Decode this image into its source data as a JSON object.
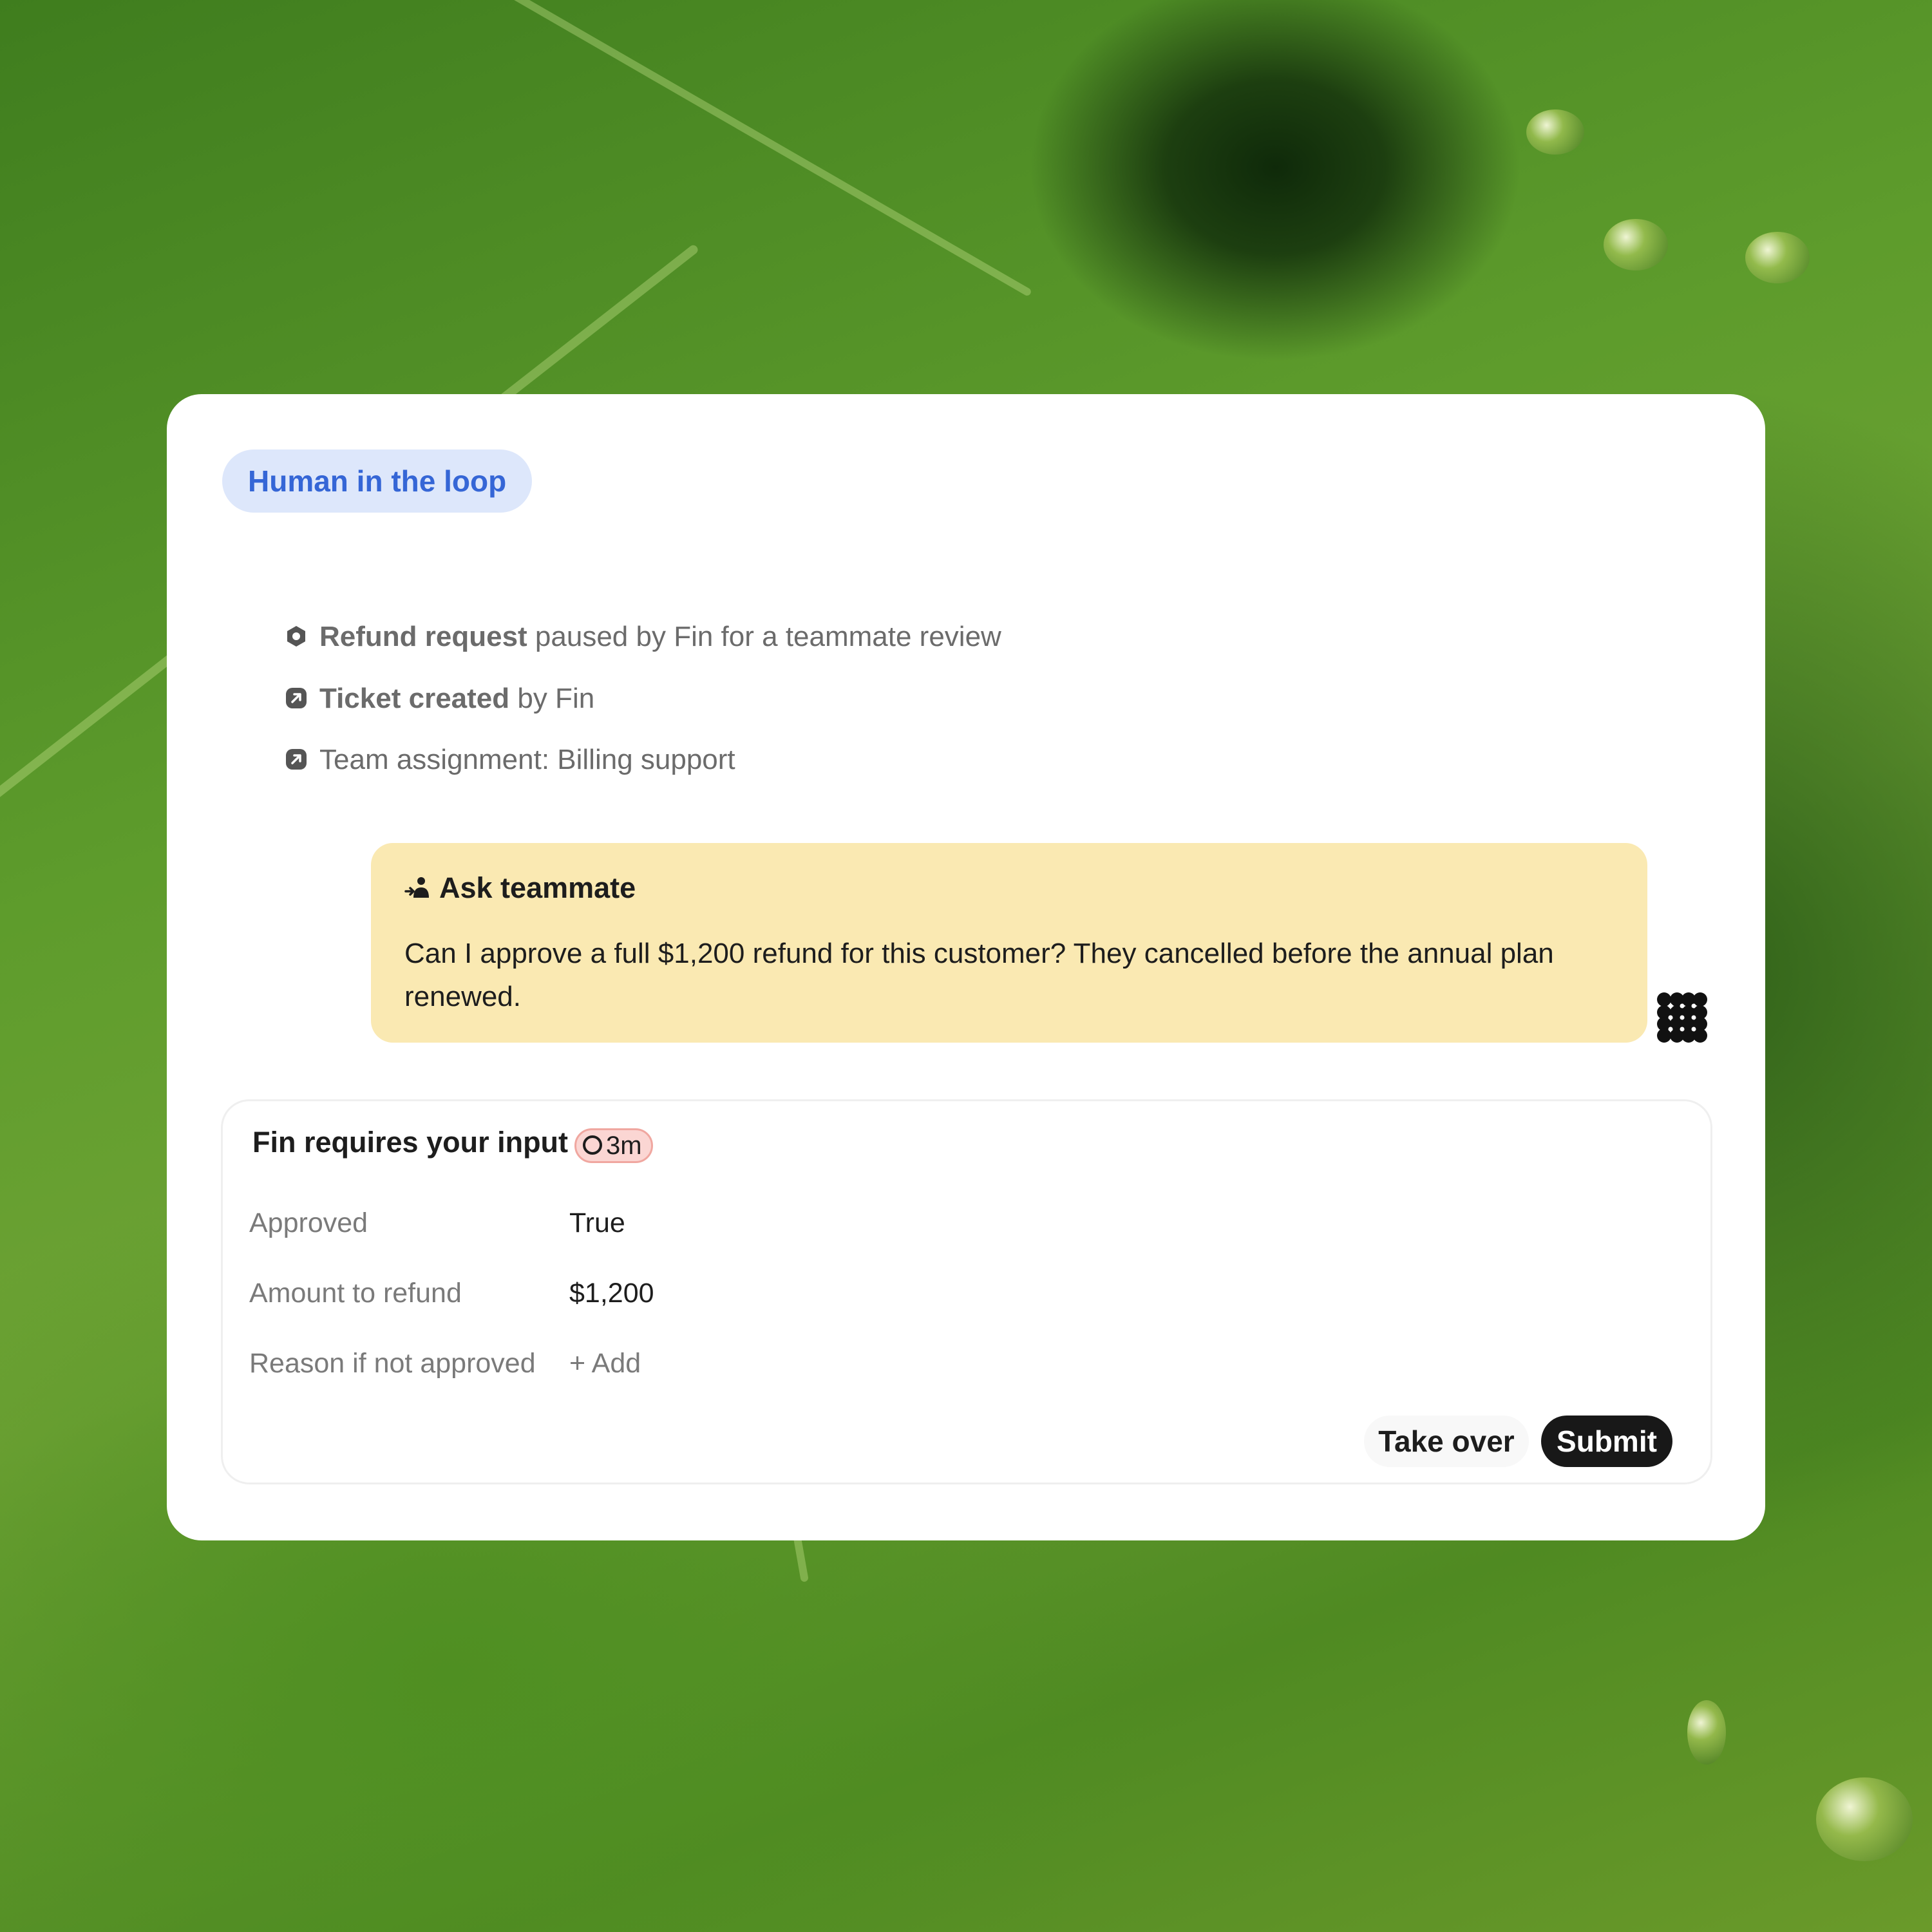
{
  "badge": {
    "label": "Human in the loop"
  },
  "events": [
    {
      "icon": "hexagon-icon",
      "bold": "Refund request",
      "rest": " paused by Fin for a teammate review"
    },
    {
      "icon": "ticket-arrow-icon",
      "bold": "Ticket created",
      "rest": " by Fin"
    },
    {
      "icon": "ticket-arrow-icon",
      "bold": "",
      "rest": "Team assignment: Billing support"
    }
  ],
  "ask": {
    "icon": "person-arrow-icon",
    "title": "Ask teammate",
    "text": "Can I approve a full $1,200 refund for this customer? They cancelled before the annual plan renewed."
  },
  "fin_avatar": {
    "icon": "fin-logo-icon"
  },
  "input_panel": {
    "title": "Fin requires your input",
    "timer": "3m",
    "timer_icon": "clock-icon",
    "fields": [
      {
        "label": "Approved",
        "value": "True"
      },
      {
        "label": "Amount to refund",
        "value": "$1,200"
      },
      {
        "label": "Reason if not approved",
        "value": "+ Add"
      }
    ],
    "take_over_label": "Take over",
    "submit_label": "Submit"
  },
  "colors": {
    "badge_bg": "#dde7fb",
    "badge_text": "#3566d6",
    "ask_bg": "#fae9b2",
    "timer_bg": "#fbd6d3",
    "submit_bg": "#181818"
  }
}
